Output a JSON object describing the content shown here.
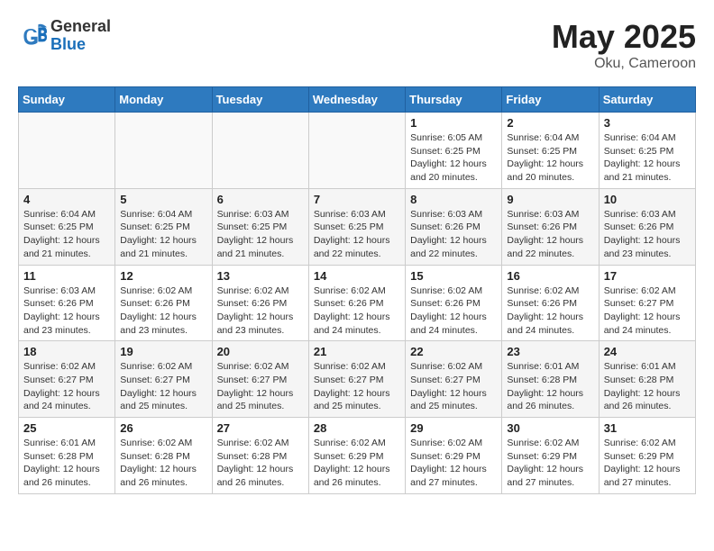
{
  "header": {
    "logo_general": "General",
    "logo_blue": "Blue",
    "title": "May 2025",
    "location": "Oku, Cameroon"
  },
  "calendar": {
    "weekdays": [
      "Sunday",
      "Monday",
      "Tuesday",
      "Wednesday",
      "Thursday",
      "Friday",
      "Saturday"
    ],
    "weeks": [
      [
        {
          "day": "",
          "info": ""
        },
        {
          "day": "",
          "info": ""
        },
        {
          "day": "",
          "info": ""
        },
        {
          "day": "",
          "info": ""
        },
        {
          "day": "1",
          "info": "Sunrise: 6:05 AM\nSunset: 6:25 PM\nDaylight: 12 hours\nand 20 minutes."
        },
        {
          "day": "2",
          "info": "Sunrise: 6:04 AM\nSunset: 6:25 PM\nDaylight: 12 hours\nand 20 minutes."
        },
        {
          "day": "3",
          "info": "Sunrise: 6:04 AM\nSunset: 6:25 PM\nDaylight: 12 hours\nand 21 minutes."
        }
      ],
      [
        {
          "day": "4",
          "info": "Sunrise: 6:04 AM\nSunset: 6:25 PM\nDaylight: 12 hours\nand 21 minutes."
        },
        {
          "day": "5",
          "info": "Sunrise: 6:04 AM\nSunset: 6:25 PM\nDaylight: 12 hours\nand 21 minutes."
        },
        {
          "day": "6",
          "info": "Sunrise: 6:03 AM\nSunset: 6:25 PM\nDaylight: 12 hours\nand 21 minutes."
        },
        {
          "day": "7",
          "info": "Sunrise: 6:03 AM\nSunset: 6:25 PM\nDaylight: 12 hours\nand 22 minutes."
        },
        {
          "day": "8",
          "info": "Sunrise: 6:03 AM\nSunset: 6:26 PM\nDaylight: 12 hours\nand 22 minutes."
        },
        {
          "day": "9",
          "info": "Sunrise: 6:03 AM\nSunset: 6:26 PM\nDaylight: 12 hours\nand 22 minutes."
        },
        {
          "day": "10",
          "info": "Sunrise: 6:03 AM\nSunset: 6:26 PM\nDaylight: 12 hours\nand 23 minutes."
        }
      ],
      [
        {
          "day": "11",
          "info": "Sunrise: 6:03 AM\nSunset: 6:26 PM\nDaylight: 12 hours\nand 23 minutes."
        },
        {
          "day": "12",
          "info": "Sunrise: 6:02 AM\nSunset: 6:26 PM\nDaylight: 12 hours\nand 23 minutes."
        },
        {
          "day": "13",
          "info": "Sunrise: 6:02 AM\nSunset: 6:26 PM\nDaylight: 12 hours\nand 23 minutes."
        },
        {
          "day": "14",
          "info": "Sunrise: 6:02 AM\nSunset: 6:26 PM\nDaylight: 12 hours\nand 24 minutes."
        },
        {
          "day": "15",
          "info": "Sunrise: 6:02 AM\nSunset: 6:26 PM\nDaylight: 12 hours\nand 24 minutes."
        },
        {
          "day": "16",
          "info": "Sunrise: 6:02 AM\nSunset: 6:26 PM\nDaylight: 12 hours\nand 24 minutes."
        },
        {
          "day": "17",
          "info": "Sunrise: 6:02 AM\nSunset: 6:27 PM\nDaylight: 12 hours\nand 24 minutes."
        }
      ],
      [
        {
          "day": "18",
          "info": "Sunrise: 6:02 AM\nSunset: 6:27 PM\nDaylight: 12 hours\nand 24 minutes."
        },
        {
          "day": "19",
          "info": "Sunrise: 6:02 AM\nSunset: 6:27 PM\nDaylight: 12 hours\nand 25 minutes."
        },
        {
          "day": "20",
          "info": "Sunrise: 6:02 AM\nSunset: 6:27 PM\nDaylight: 12 hours\nand 25 minutes."
        },
        {
          "day": "21",
          "info": "Sunrise: 6:02 AM\nSunset: 6:27 PM\nDaylight: 12 hours\nand 25 minutes."
        },
        {
          "day": "22",
          "info": "Sunrise: 6:02 AM\nSunset: 6:27 PM\nDaylight: 12 hours\nand 25 minutes."
        },
        {
          "day": "23",
          "info": "Sunrise: 6:01 AM\nSunset: 6:28 PM\nDaylight: 12 hours\nand 26 minutes."
        },
        {
          "day": "24",
          "info": "Sunrise: 6:01 AM\nSunset: 6:28 PM\nDaylight: 12 hours\nand 26 minutes."
        }
      ],
      [
        {
          "day": "25",
          "info": "Sunrise: 6:01 AM\nSunset: 6:28 PM\nDaylight: 12 hours\nand 26 minutes."
        },
        {
          "day": "26",
          "info": "Sunrise: 6:02 AM\nSunset: 6:28 PM\nDaylight: 12 hours\nand 26 minutes."
        },
        {
          "day": "27",
          "info": "Sunrise: 6:02 AM\nSunset: 6:28 PM\nDaylight: 12 hours\nand 26 minutes."
        },
        {
          "day": "28",
          "info": "Sunrise: 6:02 AM\nSunset: 6:29 PM\nDaylight: 12 hours\nand 26 minutes."
        },
        {
          "day": "29",
          "info": "Sunrise: 6:02 AM\nSunset: 6:29 PM\nDaylight: 12 hours\nand 27 minutes."
        },
        {
          "day": "30",
          "info": "Sunrise: 6:02 AM\nSunset: 6:29 PM\nDaylight: 12 hours\nand 27 minutes."
        },
        {
          "day": "31",
          "info": "Sunrise: 6:02 AM\nSunset: 6:29 PM\nDaylight: 12 hours\nand 27 minutes."
        }
      ]
    ]
  }
}
